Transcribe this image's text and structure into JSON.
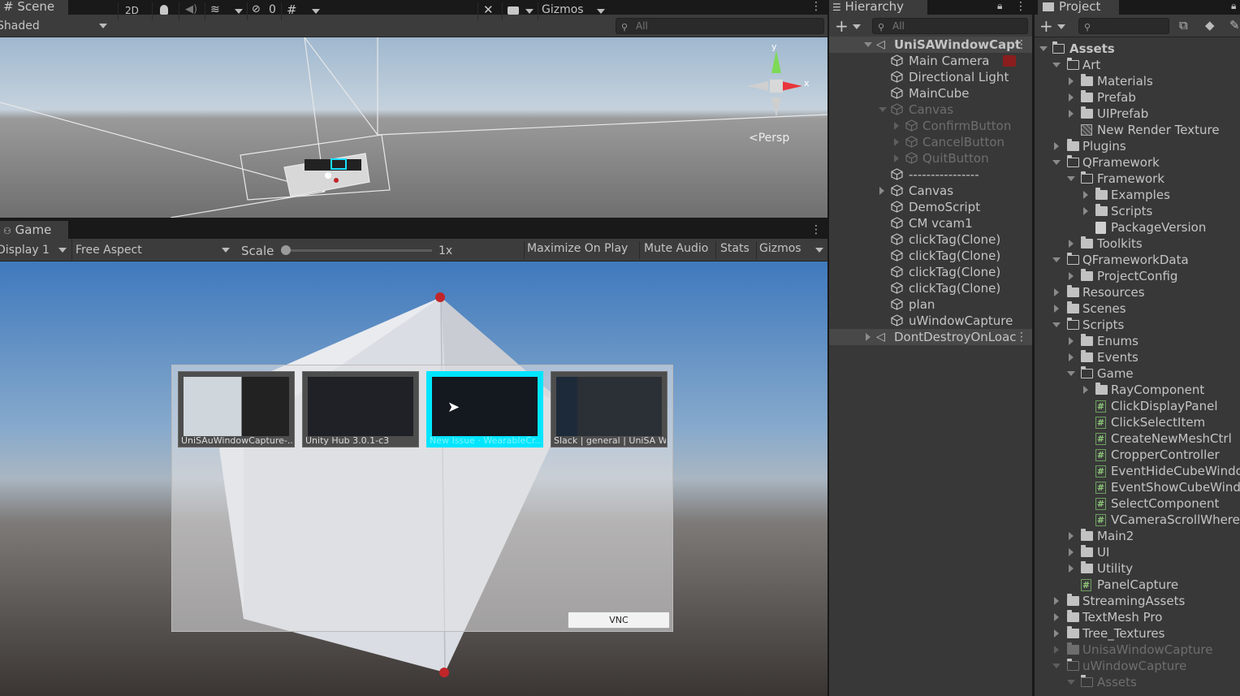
{
  "scene": {
    "tab": "Scene",
    "shading": "Shaded",
    "mode_2d": "2D",
    "hidden_count": "0",
    "gizmos": "Gizmos",
    "search_placeholder": "All",
    "persp_label": "Persp",
    "axis_y": "y",
    "axis_x": "x"
  },
  "game": {
    "tab": "Game",
    "display": "Display 1",
    "aspect": "Free Aspect",
    "scale_label": "Scale",
    "scale_value": "1x",
    "maximize": "Maximize On Play",
    "mute": "Mute Audio",
    "stats": "Stats",
    "gizmos": "Gizmos",
    "thumbnails": [
      {
        "caption": "UniSAuWindowCapture-..."
      },
      {
        "caption": "Unity Hub 3.0.1-c3"
      },
      {
        "caption": "New Issue · WearableCr..."
      },
      {
        "caption": "Slack | general | UniSA Wi..."
      }
    ],
    "vnc_button": "VNC",
    "accent_color": "#00e5ff"
  },
  "hierarchy": {
    "tab": "Hierarchy",
    "search_placeholder": "All",
    "items": [
      {
        "label": "UniSAWindowCapt"
      },
      {
        "label": "Main Camera"
      },
      {
        "label": "Directional Light"
      },
      {
        "label": "MainCube"
      },
      {
        "label": "Canvas"
      },
      {
        "label": "ConfirmButton"
      },
      {
        "label": "CancelButton"
      },
      {
        "label": "QuitButton"
      },
      {
        "label": "----------------"
      },
      {
        "label": "Canvas"
      },
      {
        "label": "DemoScript"
      },
      {
        "label": "CM vcam1"
      },
      {
        "label": "clickTag(Clone)"
      },
      {
        "label": "clickTag(Clone)"
      },
      {
        "label": "clickTag(Clone)"
      },
      {
        "label": "clickTag(Clone)"
      },
      {
        "label": "plan"
      },
      {
        "label": "uWindowCapture"
      },
      {
        "label": "DontDestroyOnLoac"
      }
    ]
  },
  "project": {
    "tab": "Project",
    "items": [
      {
        "label": "Assets"
      },
      {
        "label": "Art"
      },
      {
        "label": "Materials"
      },
      {
        "label": "Prefab"
      },
      {
        "label": "UIPrefab"
      },
      {
        "label": "New Render Texture"
      },
      {
        "label": "Plugins"
      },
      {
        "label": "QFramework"
      },
      {
        "label": "Framework"
      },
      {
        "label": "Examples"
      },
      {
        "label": "Scripts"
      },
      {
        "label": "PackageVersion"
      },
      {
        "label": "Toolkits"
      },
      {
        "label": "QFrameworkData"
      },
      {
        "label": "ProjectConfig"
      },
      {
        "label": "Resources"
      },
      {
        "label": "Scenes"
      },
      {
        "label": "Scripts"
      },
      {
        "label": "Enums"
      },
      {
        "label": "Events"
      },
      {
        "label": "Game"
      },
      {
        "label": "RayComponent"
      },
      {
        "label": "ClickDisplayPanel"
      },
      {
        "label": "ClickSelectItem"
      },
      {
        "label": "CreateNewMeshCtrl"
      },
      {
        "label": "CropperController"
      },
      {
        "label": "EventHideCubeWindow"
      },
      {
        "label": "EventShowCubeWindow"
      },
      {
        "label": "SelectComponent"
      },
      {
        "label": "VCameraScrollWhereC"
      },
      {
        "label": "Main2"
      },
      {
        "label": "UI"
      },
      {
        "label": "Utility"
      },
      {
        "label": "PanelCapture"
      },
      {
        "label": "StreamingAssets"
      },
      {
        "label": "TextMesh Pro"
      },
      {
        "label": "Tree_Textures"
      },
      {
        "label": "UnisaWindowCapture"
      },
      {
        "label": "uWindowCapture"
      },
      {
        "label": "Assets"
      }
    ]
  }
}
